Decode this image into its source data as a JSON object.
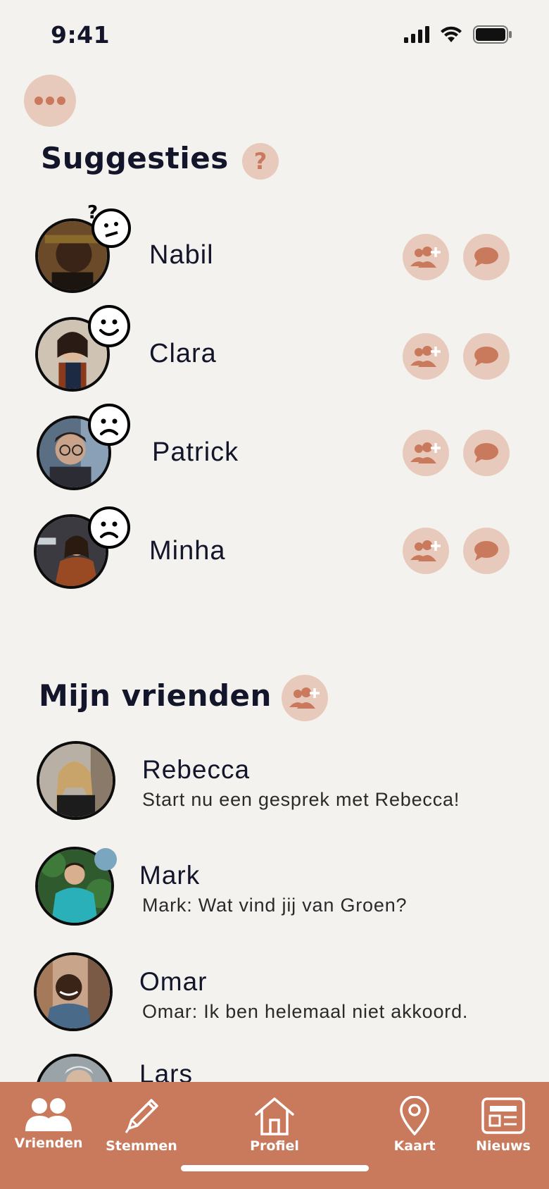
{
  "status": {
    "time": "9:41"
  },
  "suggestions": {
    "title": "Suggesties",
    "help": "?",
    "items": [
      {
        "name": "Nabil",
        "mood": "confused"
      },
      {
        "name": "Clara",
        "mood": "happy"
      },
      {
        "name": "Patrick",
        "mood": "sad"
      },
      {
        "name": "Minha",
        "mood": "sad"
      }
    ]
  },
  "friends": {
    "title": "Mijn vrienden",
    "items": [
      {
        "name": "Rebecca",
        "message": "Start nu een gesprek met Rebecca!"
      },
      {
        "name": "Mark",
        "message": "Mark: Wat vind jij van Groen?"
      },
      {
        "name": "Omar",
        "message": "Omar: Ik ben helemaal niet akkoord."
      },
      {
        "name": "Lars",
        "message": ""
      }
    ]
  },
  "tabs": [
    {
      "label": "Vrienden",
      "icon": "people-icon"
    },
    {
      "label": "Stemmen",
      "icon": "pencil-icon"
    },
    {
      "label": "Profiel",
      "icon": "house-icon"
    },
    {
      "label": "Kaart",
      "icon": "map-pin-icon"
    },
    {
      "label": "Nieuws",
      "icon": "newspaper-icon"
    }
  ],
  "colors": {
    "accent": "#c97a5c",
    "accent_light": "#e8cabc",
    "background": "#f4f2ee",
    "online": "#7aa7bf"
  }
}
